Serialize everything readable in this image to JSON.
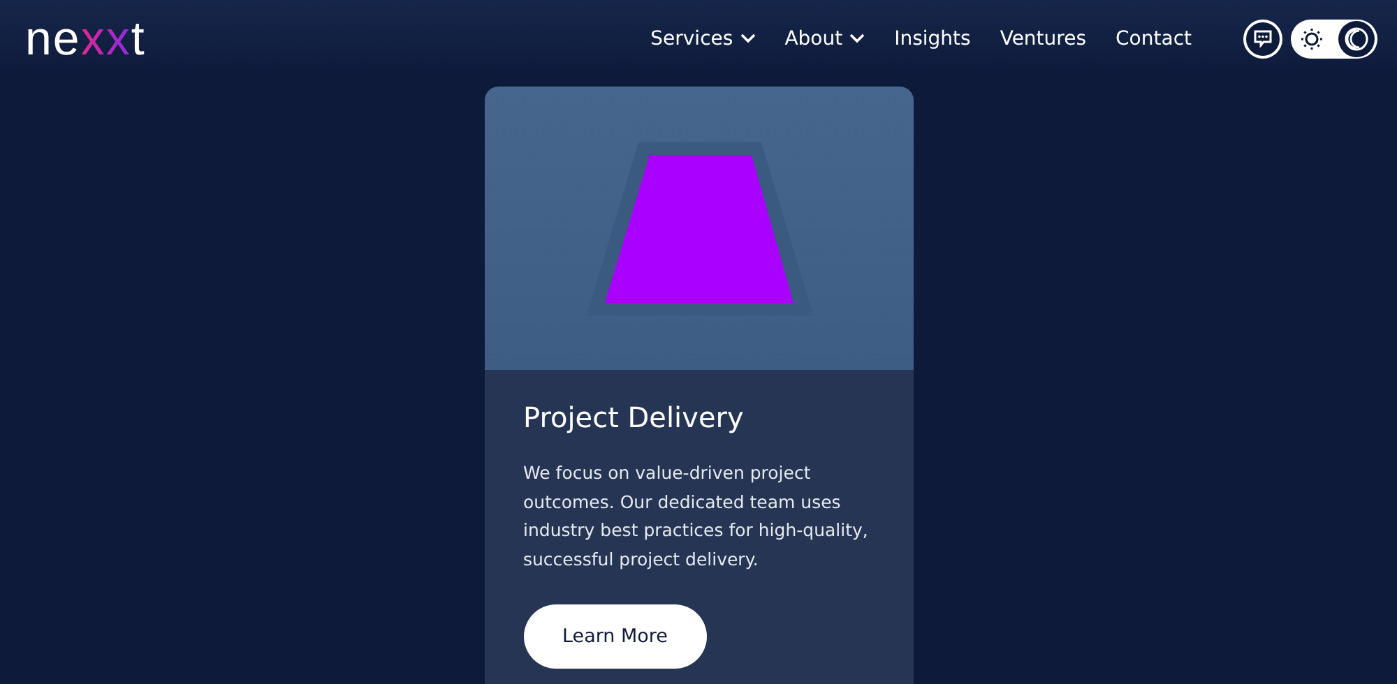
{
  "logo": [
    {
      "text": "ne",
      "accent": false
    },
    {
      "text": "xx",
      "accent": true
    },
    {
      "text": "t",
      "accent": false
    }
  ],
  "nav": [
    {
      "label": "Services",
      "has_menu": true
    },
    {
      "label": "About",
      "has_menu": true
    },
    {
      "label": "Insights",
      "has_menu": false
    },
    {
      "label": "Ventures",
      "has_menu": false
    },
    {
      "label": "Contact",
      "has_menu": false
    }
  ],
  "theme_toggle": [
    {
      "kind": "light",
      "selected": false
    },
    {
      "kind": "dark",
      "selected": true
    }
  ],
  "card": {
    "title": "Project Delivery",
    "text": "We focus on value-driven project outcomes. Our dedicated team uses industry best practices for high-quality, successful project delivery.",
    "button": "Learn More"
  }
}
